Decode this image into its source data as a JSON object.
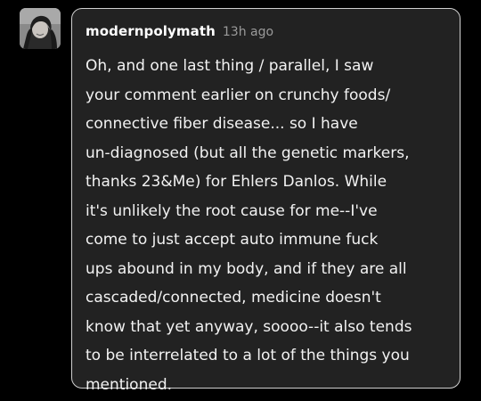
{
  "post": {
    "author": "modernpolymath",
    "timestamp": "13h ago",
    "avatar_icon": "user-avatar-photo",
    "lines": [
      "Oh, and one last thing / parallel, I saw",
      "your comment earlier on crunchy foods/",
      "connective fiber disease... so I have",
      "un-diagnosed (but all the genetic markers,",
      "thanks 23&Me) for Ehlers Danlos. While",
      "it's unlikely the root cause for me--I've",
      "come to just accept auto immune fuck",
      "ups abound in my body, and if they are all",
      "cascaded/connected, medicine doesn't",
      "know that yet anyway, soooo--it also tends",
      "to be interrelated to a lot of the things you",
      "mentioned."
    ]
  },
  "colors": {
    "background": "#000000",
    "bubble_bg": "#222222",
    "bubble_border": "#cfcfcf",
    "text": "#f2f2f2",
    "muted": "#9a9a9a"
  }
}
